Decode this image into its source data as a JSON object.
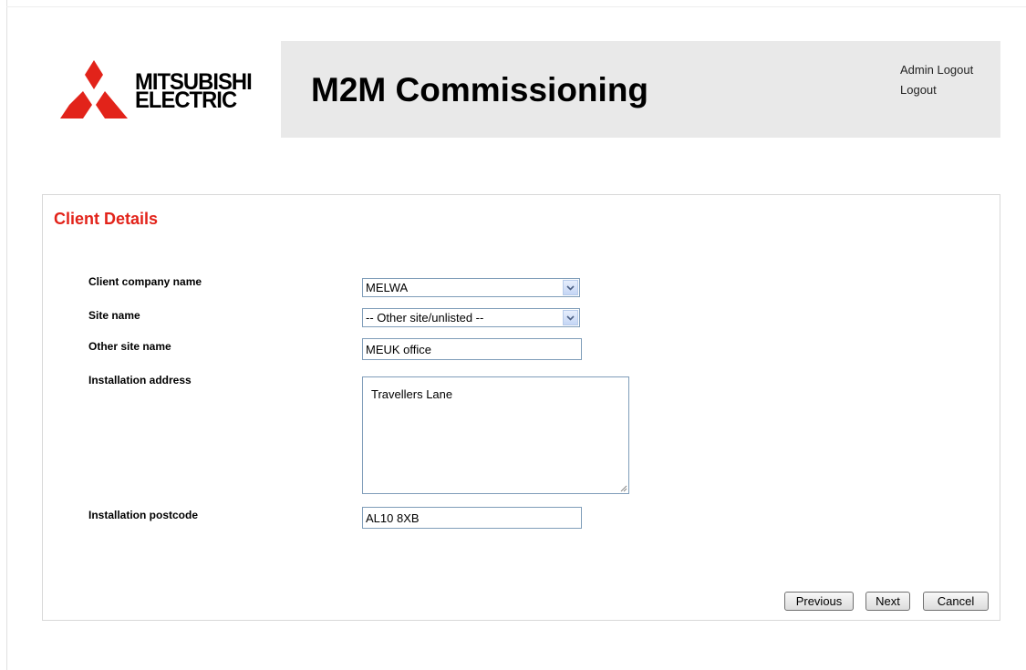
{
  "brand": {
    "logo_line1": "MITSUBISHI",
    "logo_line2": "ELECTRIC",
    "logo_color": "#e2231a",
    "app_title": "M2M Commissioning"
  },
  "header": {
    "admin_logout": "Admin Logout",
    "logout": "Logout"
  },
  "form": {
    "title": "Client Details",
    "title_color": "#e2231a",
    "fields": {
      "client_company_name": {
        "label": "Client company name",
        "value": "MELWA"
      },
      "site_name": {
        "label": "Site name",
        "value": "-- Other site/unlisted --"
      },
      "other_site_name": {
        "label": "Other site name",
        "value": "MEUK office"
      },
      "installation_address": {
        "label": "Installation address",
        "value": "Travellers Lane"
      },
      "installation_postcode": {
        "label": "Installation postcode",
        "value": "AL10 8XB"
      }
    },
    "buttons": {
      "previous": "Previous",
      "next": "Next",
      "cancel": "Cancel"
    }
  }
}
